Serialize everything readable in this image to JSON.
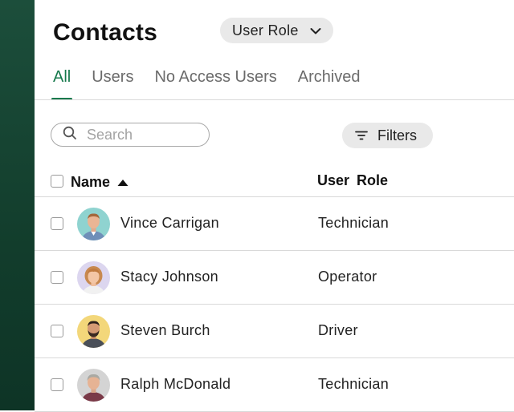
{
  "page": {
    "title": "Contacts"
  },
  "tabs": [
    {
      "label": "All",
      "active": true
    },
    {
      "label": "Users",
      "active": false
    },
    {
      "label": "No Access Users",
      "active": false
    },
    {
      "label": "Archived",
      "active": false
    }
  ],
  "toolbar": {
    "search_placeholder": "Search",
    "role_filter_label": "User Role",
    "filters_label": "Filters"
  },
  "table": {
    "columns": {
      "name": "Name",
      "role": "User  Role"
    },
    "sort": "name-ascending",
    "rows": [
      {
        "name": "Vince Carrigan",
        "role": "Technician",
        "avatar_bg": "#8fd3d0"
      },
      {
        "name": "Stacy Johnson",
        "role": "Operator",
        "avatar_bg": "#dcd6ef"
      },
      {
        "name": "Steven Burch",
        "role": "Driver",
        "avatar_bg": "#f3d77a"
      },
      {
        "name": "Ralph McDonald",
        "role": "Technician",
        "avatar_bg": "#d4d4d4"
      }
    ]
  },
  "colors": {
    "accent": "#16794c",
    "sidebar": "#164632"
  }
}
